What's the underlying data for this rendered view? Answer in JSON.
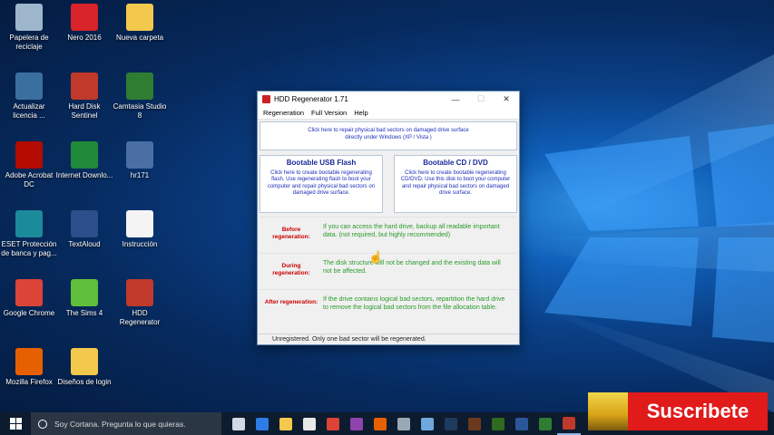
{
  "desktop": {
    "icons": [
      {
        "label": "Papelera de reciclaje",
        "icon": "recycle-bin-icon",
        "color": "#9db6cc"
      },
      {
        "label": "Nero 2016",
        "icon": "nero-icon",
        "color": "#d8232a"
      },
      {
        "label": "Nueva carpeta",
        "icon": "folder-icon",
        "color": "#f2c94c"
      },
      {
        "label": "Actualizar licencia ...",
        "icon": "eset-update-icon",
        "color": "#3a6fa0"
      },
      {
        "label": "Hard Disk Sentinel",
        "icon": "hard-disk-sentinel-icon",
        "color": "#c0392b"
      },
      {
        "label": "Camtasia Studio 8",
        "icon": "camtasia-icon",
        "color": "#2e7d32"
      },
      {
        "label": "Adobe Acrobat DC",
        "icon": "acrobat-icon",
        "color": "#b30b00"
      },
      {
        "label": "Internet Downlo...",
        "icon": "idm-icon",
        "color": "#1f8a3a"
      },
      {
        "label": "hr171",
        "icon": "shortcut-icon",
        "color": "#4a6fa5"
      },
      {
        "label": "ESET Protección de banca y pag...",
        "icon": "eset-icon",
        "color": "#1b8a9a"
      },
      {
        "label": "TextAloud",
        "icon": "textaloud-icon",
        "color": "#2b4f8a"
      },
      {
        "label": "Instrucción",
        "icon": "document-icon",
        "color": "#f4f4f4"
      },
      {
        "label": "Google Chrome",
        "icon": "chrome-icon",
        "color": "#db4437"
      },
      {
        "label": "The Sims 4",
        "icon": "sims-icon",
        "color": "#5fbf3a"
      },
      {
        "label": "HDD Regenerator",
        "icon": "hdd-regenerator-icon",
        "color": "#c0392b"
      },
      {
        "label": "Mozilla Firefox",
        "icon": "firefox-icon",
        "color": "#e66000"
      },
      {
        "label": "Diseños de login",
        "icon": "folder-icon",
        "color": "#f2c94c"
      }
    ]
  },
  "window": {
    "title": "HDD Regenerator 1.71",
    "minimize": "—",
    "maximize": "☐",
    "close": "✕",
    "menu": [
      "Regeneration",
      "Full Version",
      "Help"
    ],
    "top_panel": "Click here to repair physical bad sectors on damaged drive surface directly under Windows (XP / Vista )",
    "usb": {
      "title": "Bootable USB Flash",
      "text": "Click here to create bootable regenerating flash. Use regenerating flash to boot your computer and repair physical bad sectors on damaged drive surface."
    },
    "cd": {
      "title": "Bootable CD / DVD",
      "text": "Click here to create bootable regenerating CD/DVD. Use this disk to boot your computer and repair physical bad sectors on damaged drive surface."
    },
    "rows": [
      {
        "label": "Before regeneration:",
        "text": "If you can access the hard drive, backup all readable important data. (not required, but highly recommended)"
      },
      {
        "label": "During regeneration:",
        "text": "The disk structure will not be changed and the existing data will not be affected."
      },
      {
        "label": "After regeneration:",
        "text": "If the drive contains logical bad sectors, repartition the hard drive to remove the logical bad sectors from the file allocation table."
      }
    ],
    "status": "Unregistered. Only one bad sector will be regenerated."
  },
  "taskbar": {
    "search_placeholder": "Soy Cortana. Pregunta lo que quieras.",
    "apps": [
      {
        "icon": "task-view-icon",
        "color": "#cfd8e3"
      },
      {
        "icon": "edge-icon",
        "color": "#2d7be5"
      },
      {
        "icon": "file-explorer-icon",
        "color": "#f2c94c"
      },
      {
        "icon": "store-icon",
        "color": "#e8e8e8"
      },
      {
        "icon": "chrome-icon",
        "color": "#db4437"
      },
      {
        "icon": "visual-studio-icon",
        "color": "#8e44ad"
      },
      {
        "icon": "firefox-icon",
        "color": "#e66000"
      },
      {
        "icon": "tools-icon",
        "color": "#9aa7b4"
      },
      {
        "icon": "link-icon",
        "color": "#6fa8dc"
      },
      {
        "icon": "photoshop-icon",
        "color": "#1e3a5f"
      },
      {
        "icon": "illustrator-icon",
        "color": "#6b3a1e"
      },
      {
        "icon": "dreamweaver-icon",
        "color": "#2f6b1e"
      },
      {
        "icon": "word-icon",
        "color": "#2b579a"
      },
      {
        "icon": "camtasia-icon",
        "color": "#2e7d32"
      },
      {
        "icon": "hdd-regenerator-icon",
        "color": "#c0392b"
      }
    ]
  },
  "overlay": {
    "subscribe_label": "Suscribete"
  }
}
